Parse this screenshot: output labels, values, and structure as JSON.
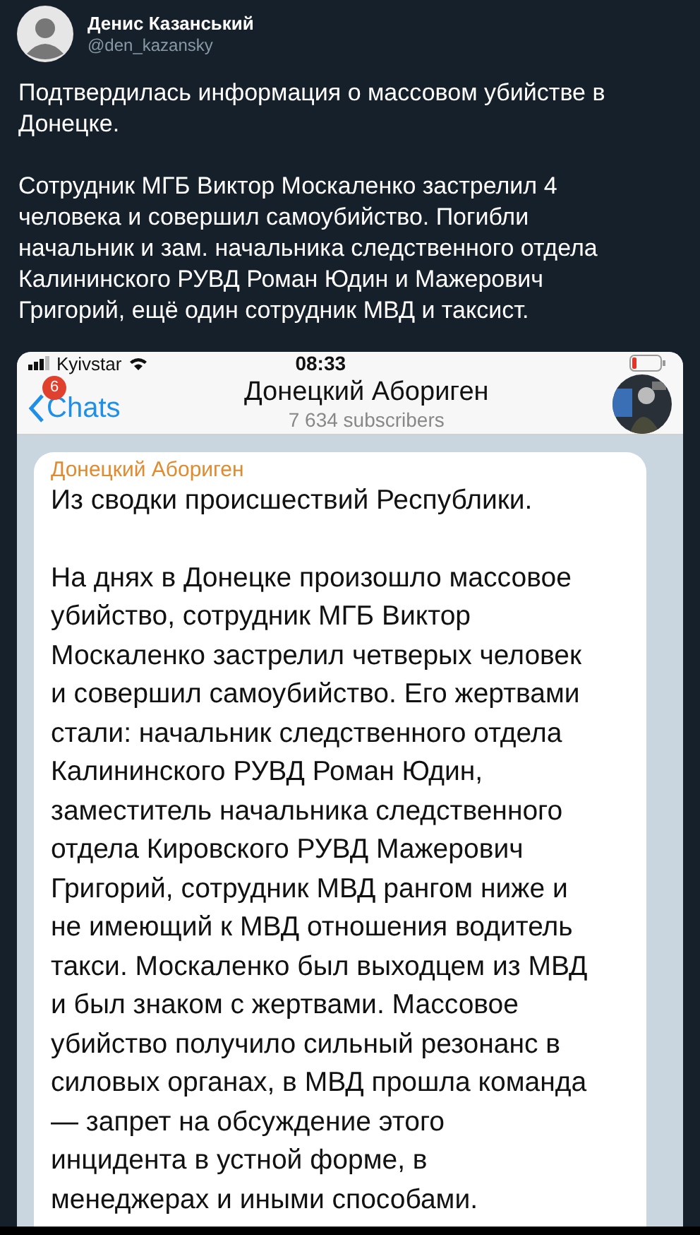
{
  "tweet": {
    "author": "Денис Казанський",
    "handle": "@den_kazansky",
    "paragraphs": [
      [
        "Подтвердилась информация о массовом убийстве в",
        "Донецке."
      ],
      [
        "Сотрудник МГБ Виктор Москаленко застрелил 4",
        "человека и совершил самоубийство. Погибли",
        "начальник и зам. начальника следственного отдела",
        "Калининского РУВД Роман Юдин и Мажерович",
        "Григорий, ещё один сотрудник МВД и таксист."
      ]
    ]
  },
  "screenshot": {
    "status_bar": {
      "carrier": "Kyivstar",
      "time": "08:33"
    },
    "nav": {
      "back": "Chats",
      "badge": "6",
      "title": "Донецкий Абориген",
      "subtitle": "7 634 subscribers"
    },
    "message": {
      "sender": "Донецкий Абориген",
      "paragraphs": [
        [
          "Из сводки происшествий Республики."
        ],
        [
          "На днях в Донецке произошло массовое",
          "убийство, сотрудник МГБ Виктор",
          "Москаленко застрелил четверых человек",
          "и совершил самоубийство. Его жертвами",
          "стали: начальник следственного отдела",
          "Калининского РУВД Роман Юдин,",
          "заместитель начальника следственного",
          "отдела Кировского РУВД Мажерович",
          "Григорий, сотрудник МВД рангом ниже и",
          "не имеющий к МВД отношения водитель",
          "такси. Москаленко был выходцем из МВД",
          "и был знаком с жертвами. Массовое",
          "убийство получило сильный резонанс в",
          "силовых органах, в МВД прошла команда",
          "— запрет на обсуждение этого",
          "инцидента в устной форме, в",
          "менеджерах и иными способами."
        ]
      ]
    }
  }
}
